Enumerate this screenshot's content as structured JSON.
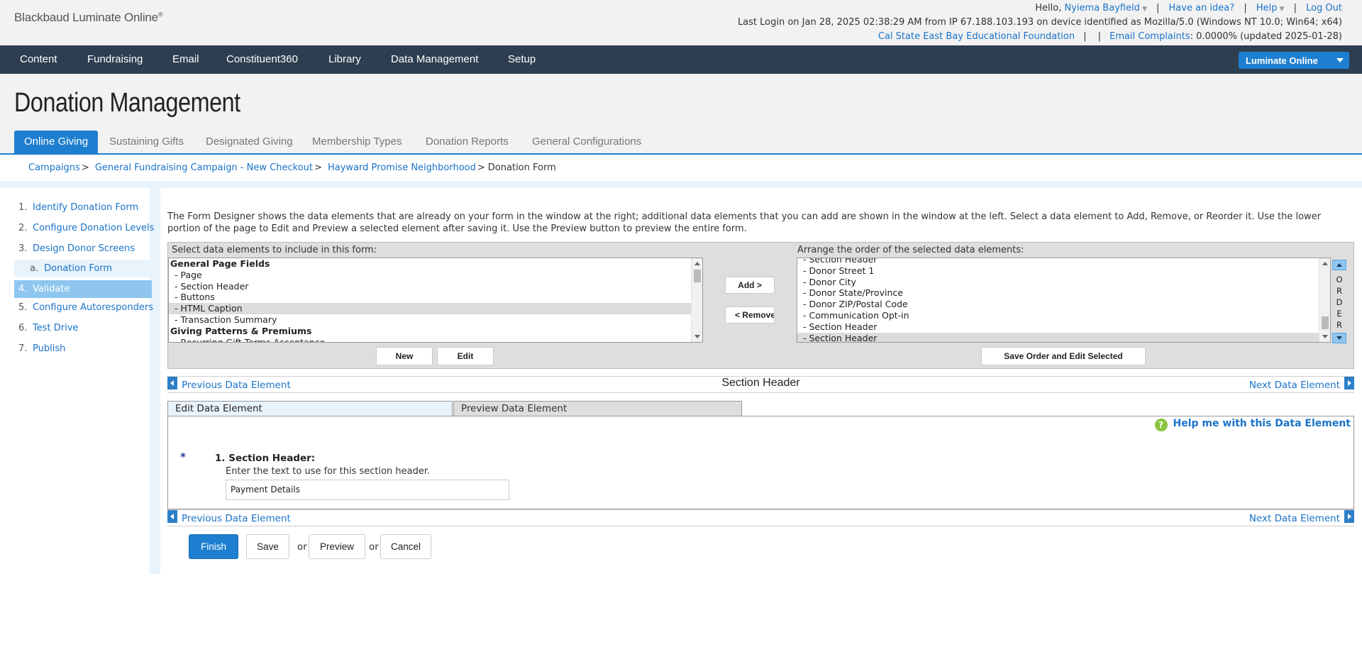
{
  "brand": {
    "logo": "Blackbaud Luminate Online",
    "logo_mark": "®"
  },
  "utility": {
    "greeting": "Hello,",
    "user": "Nyiema Bayfield",
    "idea": "Have an idea?",
    "help": "Help",
    "logout": "Log Out",
    "last_login": "Last Login on Jan 28, 2025 02:38:29 AM from IP 67.188.103.193 on device identified as Mozilla/5.0 (Windows NT 10.0; Win64; x64)",
    "org": "Cal State East Bay Educational Foundation",
    "complaints_label": "Email Complaints",
    "complaints_value": ": 0.0000% (updated 2025-01-28)"
  },
  "nav": {
    "items": [
      "Content",
      "Fundraising",
      "Email",
      "Constituent360",
      "Library",
      "Data Management",
      "Setup"
    ],
    "luminate_button": "Luminate Online"
  },
  "page": {
    "title": "Donation Management",
    "tabs": [
      "Online Giving",
      "Sustaining Gifts",
      "Designated Giving",
      "Membership Types",
      "Donation Reports",
      "General Configurations"
    ]
  },
  "breadcrumb": {
    "items": [
      "Campaigns",
      "General Fundraising Campaign - New Checkout",
      "Hayward Promise Neighborhood"
    ],
    "current": "Donation Form"
  },
  "steps": [
    {
      "num": "1.",
      "label": "Identify Donation Form"
    },
    {
      "num": "2.",
      "label": "Configure Donation Levels"
    },
    {
      "num": "3.",
      "label": "Design Donor Screens"
    },
    {
      "num": "a.",
      "label": "Donation Form"
    },
    {
      "num": "4.",
      "label": "Validate"
    },
    {
      "num": "5.",
      "label": "Configure Autoresponders"
    },
    {
      "num": "6.",
      "label": "Test Drive"
    },
    {
      "num": "7.",
      "label": "Publish"
    }
  ],
  "designer": {
    "intro": "The Form Designer shows the data elements that are already on your form in the window at the right; additional data elements that you can add are shown in the window at the left. Select a data element to Add, Remove, or Reorder it. Use the lower portion of the page to Edit and Preview a selected element after saving it. Use the Preview button to preview the entire form.",
    "available_label": "Select data elements to include in this form:",
    "available": [
      "General Page Fields",
      " - Page",
      " - Section Header",
      " - Buttons",
      " - HTML Caption",
      " - Transaction Summary",
      "Giving Patterns & Premiums",
      " - Recurring Gift Terms Acceptance"
    ],
    "add_button": "Add >",
    "remove_button": "< Remove",
    "selected_label": "Arrange the order of the selected data elements:",
    "selected": [
      " - Section Header",
      " - Donor Street 1",
      " - Donor City",
      " - Donor State/Province",
      " - Donor ZIP/Postal Code",
      " - Communication Opt-in",
      " - Section Header",
      " - Section Header"
    ],
    "order_letters": [
      "O",
      "R",
      "D",
      "E",
      "R"
    ],
    "new_button": "New",
    "edit_button": "Edit",
    "save_order_button": "Save Order and Edit Selected"
  },
  "element": {
    "prev": "Previous Data Element",
    "next": "Next Data Element",
    "title": "Section Header",
    "tab_edit": "Edit Data Element",
    "tab_preview": "Preview Data Element",
    "help_icon": "?",
    "help_link": "Help me with this Data Element",
    "required_mark": "*",
    "field_label": "1. Section Header:",
    "field_help": "Enter the text to use for this section header.",
    "field_value": "Payment Details"
  },
  "actions": {
    "finish": "Finish",
    "save": "Save",
    "or": "or",
    "preview": "Preview",
    "cancel": "Cancel"
  },
  "colors": {
    "nav_bg": "#2d3e50",
    "accent": "#1e7fd0",
    "active_step": "#8ec6ef",
    "help_icon": "#8ac43f"
  }
}
